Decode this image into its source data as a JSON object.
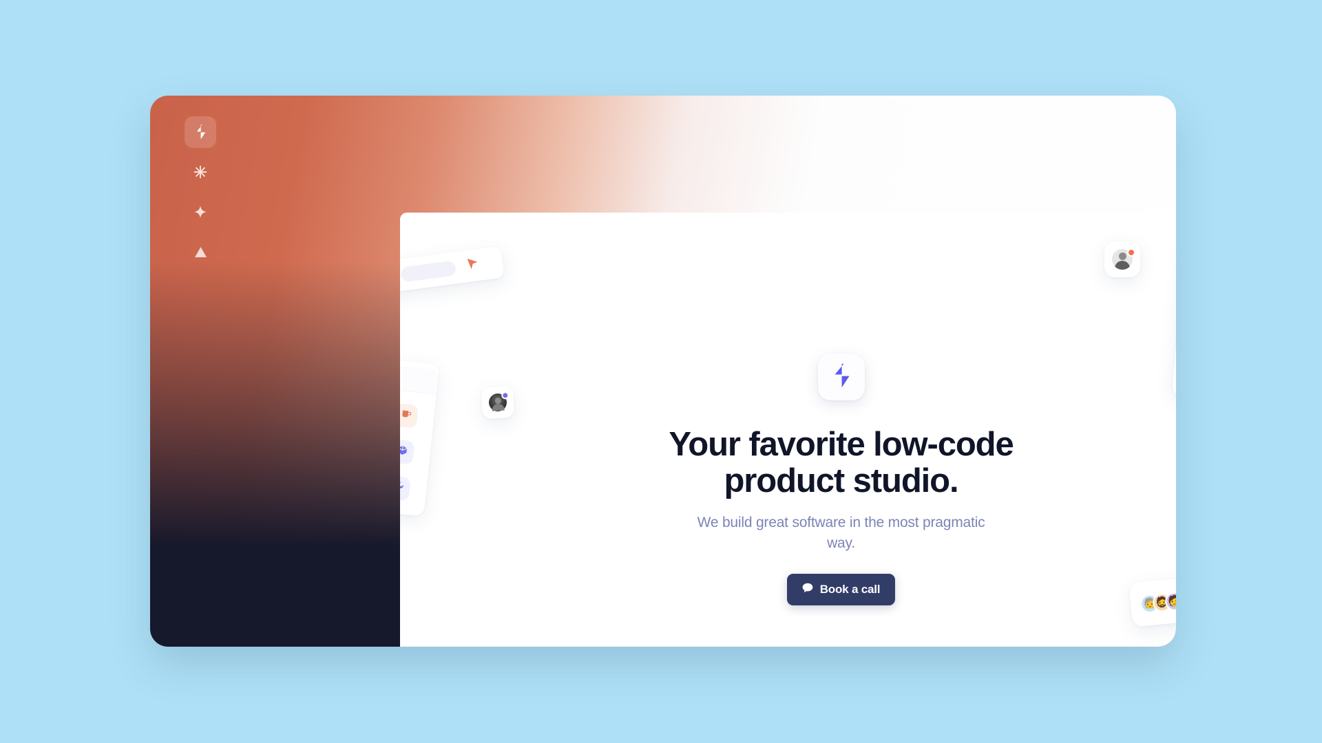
{
  "page": {
    "background_color": "#aee1f7",
    "window": {
      "gradient_top_left": "#c9624a",
      "gradient_top_right": "#ffffff",
      "gradient_bottom": "#16182b"
    }
  },
  "sidebar": {
    "items": [
      {
        "icon": "bolt-logo-icon",
        "label": "Home",
        "active": true
      },
      {
        "icon": "sparkle-asterisk-icon",
        "label": "Sparkle",
        "active": false
      },
      {
        "icon": "four-point-star-icon",
        "label": "Star",
        "active": false
      },
      {
        "icon": "triangle-icon",
        "label": "Triangle",
        "active": false
      }
    ]
  },
  "hero": {
    "logo_icon": "bolt-logo-icon",
    "logo_color": "#5b5bec",
    "title": "Your favorite low-code product studio.",
    "title_color": "#111529",
    "subtitle": "We build great software in the most pragmatic way.",
    "subtitle_color": "#7c84b5",
    "cta": {
      "label": "Book a call",
      "icon": "chat-bubble-icon",
      "background_color": "#313d66",
      "text_color": "#ffffff"
    }
  },
  "decorations": {
    "toolbar_card": {
      "name": "floating-toolbar-card",
      "placeholders": 2,
      "cursor_icon": "cursor-arrow-icon",
      "cursor_color": "#e8775a"
    },
    "tool_panel_card": {
      "name": "floating-tool-panel-card",
      "tiles": [
        {
          "icon": "coffee-mug-icon",
          "color": "#e0795c",
          "tint": "#fdf0e9"
        },
        {
          "icon": "cube-box-icon",
          "color": "#6f6fe8",
          "tint": "#f0f0fe"
        },
        {
          "icon": "wrench-icon",
          "color": "#6f6fe8",
          "tint": "#f0f0fe"
        }
      ]
    },
    "avatar_chip_card": {
      "name": "floating-avatar-chip-card",
      "avatar_icon": "user-avatar-icon",
      "badge_color": "#6f6fe8"
    },
    "avatar_notify_card": {
      "name": "floating-avatar-notify-card",
      "avatar_icon": "user-avatar-icon",
      "badge_color": "#f2714e"
    },
    "icon_rail_card": {
      "name": "floating-icon-rail-card",
      "tiles": [
        {
          "icon": "droplet-icon",
          "color": "#6f6fe8",
          "tint": "#f0f0fe"
        },
        {
          "icon": "cursor-arrow-icon",
          "color": "#e8825f",
          "tint": "#fdf0e9"
        },
        {
          "icon": "code-brackets-icon",
          "color": "#6f6fe8",
          "tint": "#f0f0fe"
        },
        {
          "icon": "puzzle-piece-icon",
          "color": "#e8734e",
          "tint": "#fdf0e9"
        }
      ]
    },
    "composer_card": {
      "name": "floating-composer-card",
      "avatars": [
        {
          "icon": "user-avatar-icon",
          "background": "#bfe3f6",
          "glyph": "👴"
        },
        {
          "icon": "user-avatar-icon",
          "background": "#f6d9ad",
          "glyph": "🧔"
        },
        {
          "icon": "user-avatar-icon",
          "background": "#cfc2f2",
          "glyph": "🧑"
        }
      ],
      "input_placeholder": "",
      "send_icon": "send-cursor-icon",
      "send_color": "#6f6fe8"
    }
  }
}
